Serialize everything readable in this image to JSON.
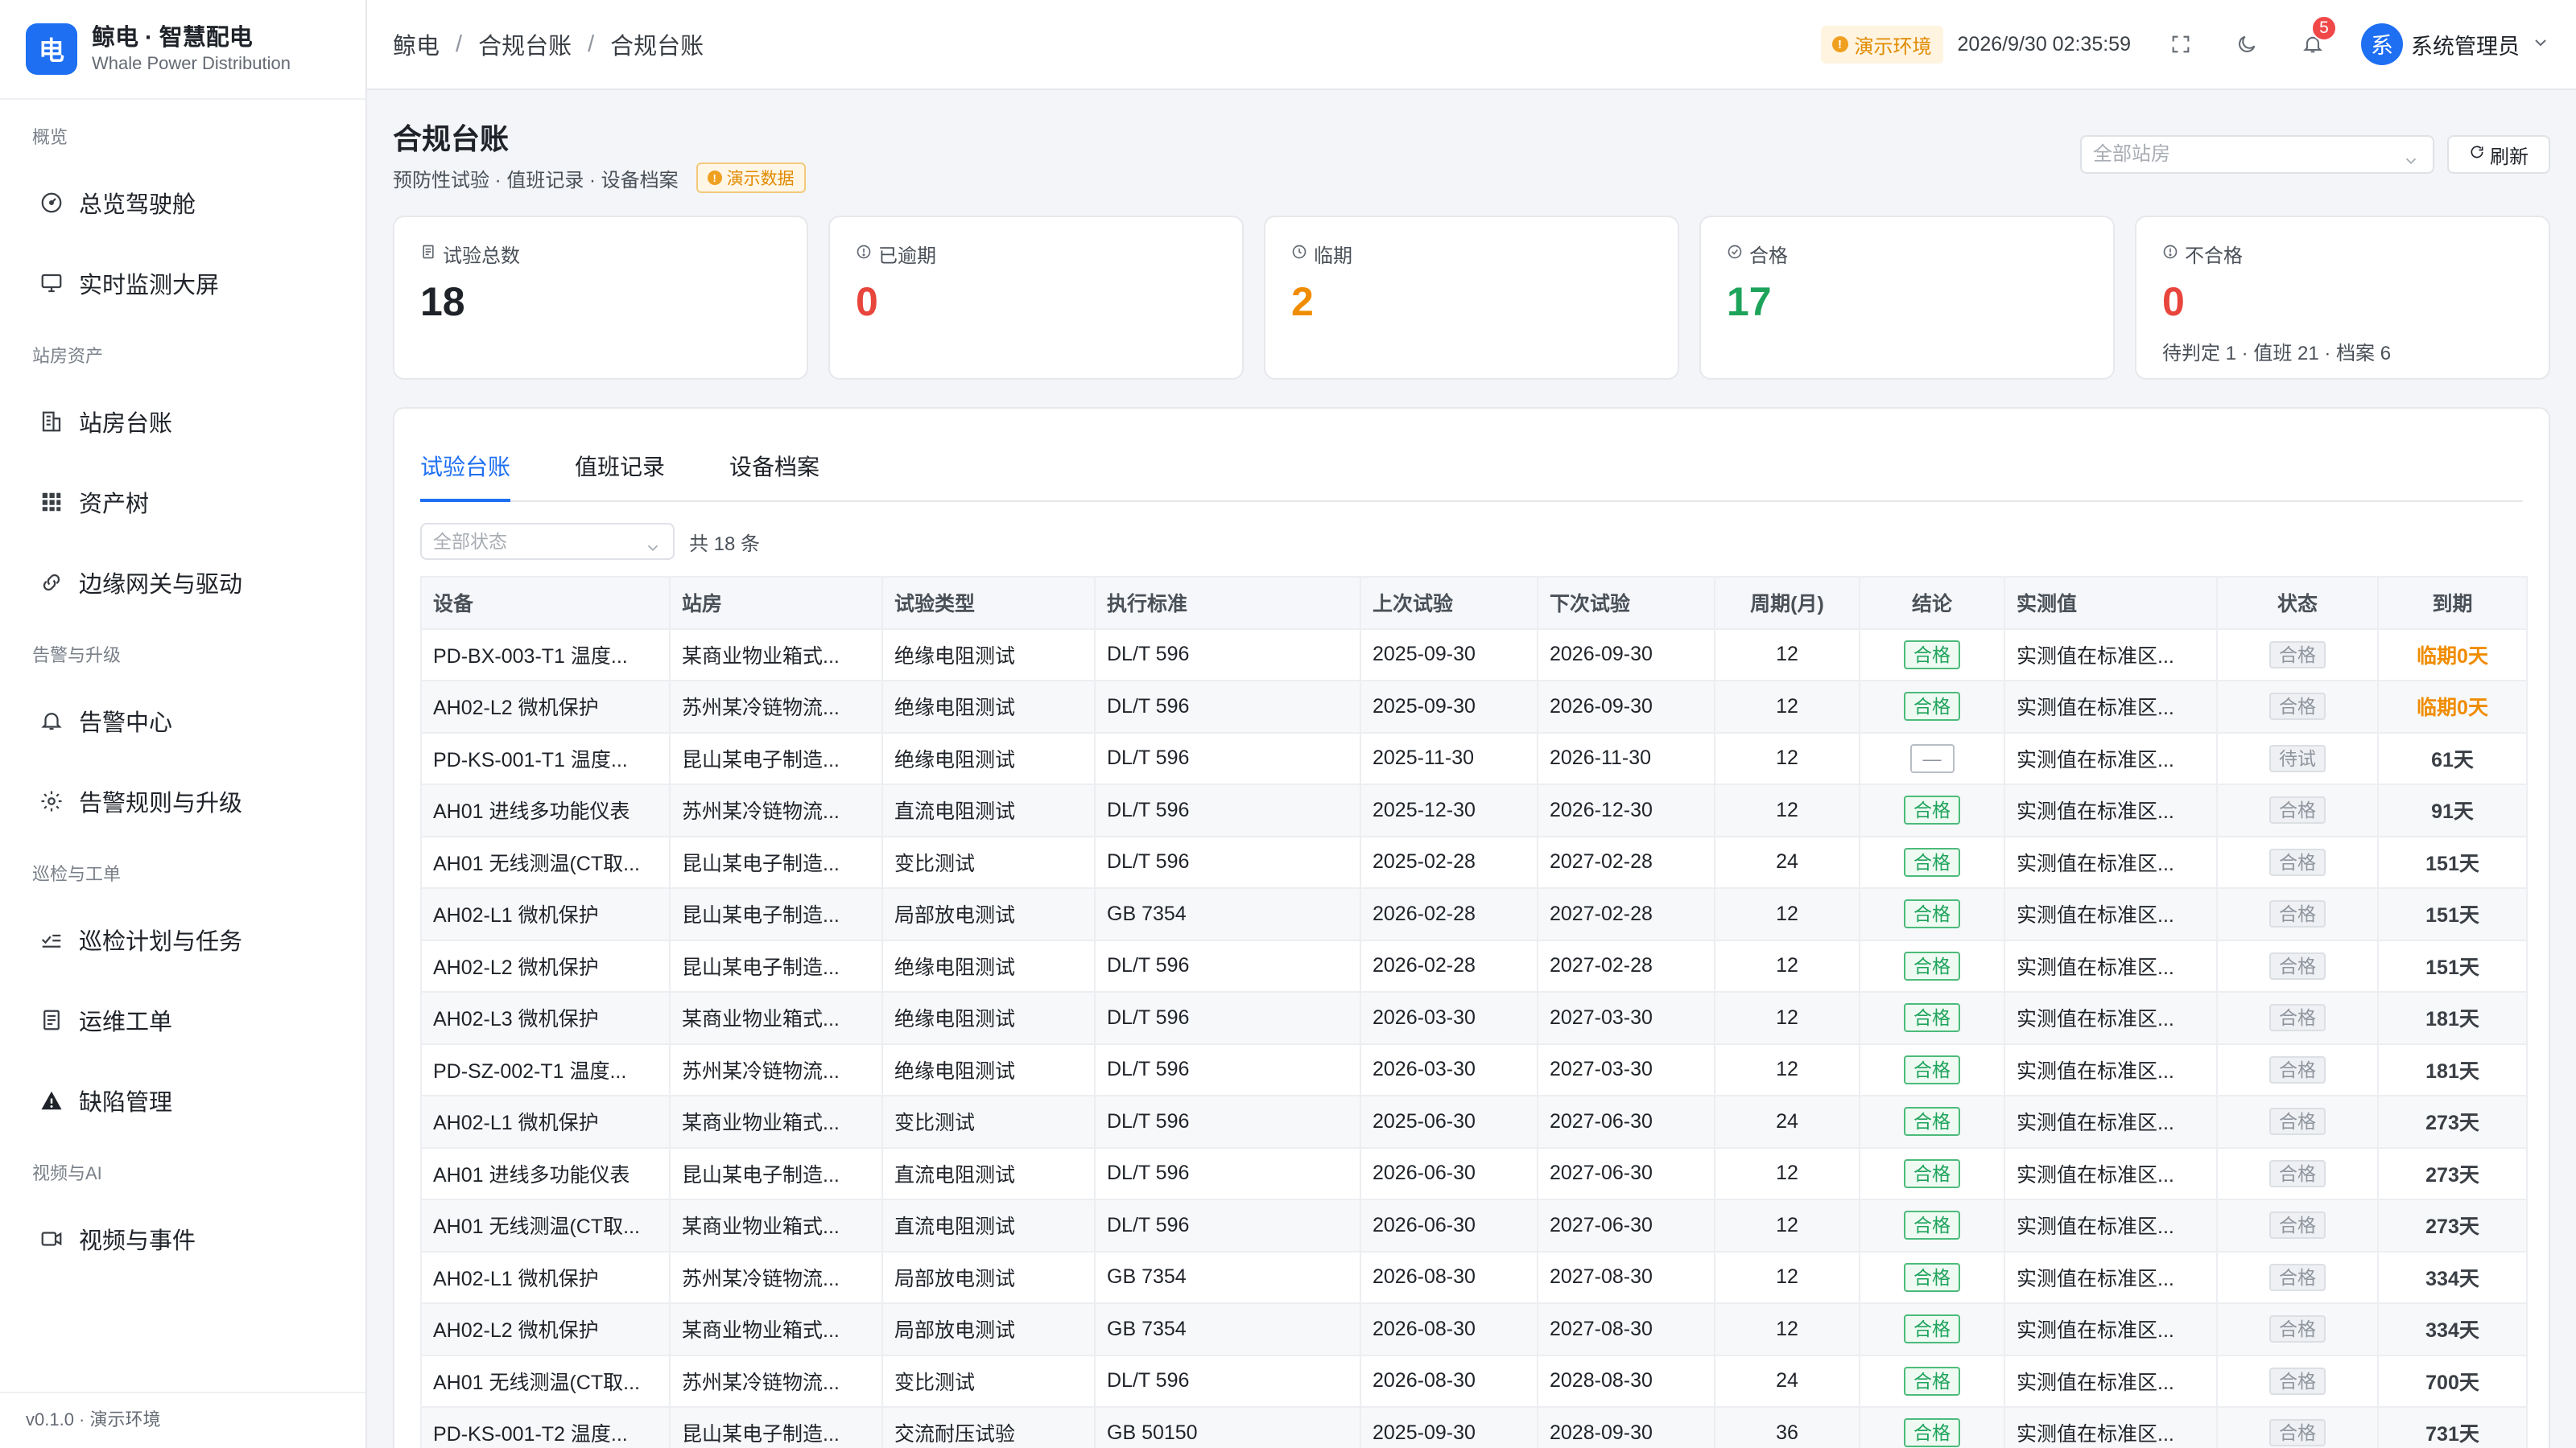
{
  "brand": {
    "logo_char": "电",
    "title": "鲸电 · 智慧配电",
    "subtitle": "Whale Power Distribution"
  },
  "sidebar": {
    "groups": [
      {
        "title": "概览",
        "items": [
          {
            "label": "总览驾驶舱",
            "icon": "dashboard-icon"
          },
          {
            "label": "实时监测大屏",
            "icon": "monitor-icon"
          }
        ]
      },
      {
        "title": "站房资产",
        "items": [
          {
            "label": "站房台账",
            "icon": "building-icon"
          },
          {
            "label": "资产树",
            "icon": "grid-icon"
          },
          {
            "label": "边缘网关与驱动",
            "icon": "link-icon"
          }
        ]
      },
      {
        "title": "告警与升级",
        "items": [
          {
            "label": "告警中心",
            "icon": "bell-icon"
          },
          {
            "label": "告警规则与升级",
            "icon": "gear-icon"
          }
        ]
      },
      {
        "title": "巡检与工单",
        "items": [
          {
            "label": "巡检计划与任务",
            "icon": "checklist-icon"
          },
          {
            "label": "运维工单",
            "icon": "document-icon"
          },
          {
            "label": "缺陷管理",
            "icon": "warning-icon"
          }
        ]
      },
      {
        "title": "视频与AI",
        "items": [
          {
            "label": "视频与事件",
            "icon": "video-icon"
          }
        ]
      }
    ],
    "footer": "v0.1.0 · 演示环境"
  },
  "header": {
    "breadcrumb": [
      "鲸电",
      "合规台账",
      "合规台账"
    ],
    "env_badge": "演示环境",
    "datetime": "2026/9/30 02:35:59",
    "notification_count": "5",
    "avatar_char": "系",
    "username": "系统管理员"
  },
  "page": {
    "title": "合规台账",
    "subtitle": "预防性试验 · 值班记录 · 设备档案",
    "demo_tag": "演示数据",
    "station_placeholder": "全部站房",
    "refresh_label": "刷新"
  },
  "stats": [
    {
      "label": "试验总数",
      "value": "18",
      "color": "#1f2329",
      "icon": "document-icon"
    },
    {
      "label": "已逾期",
      "value": "0",
      "color": "#e8453c",
      "icon": "alert-circle-icon"
    },
    {
      "label": "临期",
      "value": "2",
      "color": "#f08c00",
      "icon": "clock-icon"
    },
    {
      "label": "合格",
      "value": "17",
      "color": "#1ea35b",
      "icon": "check-circle-icon"
    },
    {
      "label": "不合格",
      "value": "0",
      "color": "#e8453c",
      "icon": "alert-circle-icon",
      "extra": "待判定 1 · 值班 21 · 档案 6"
    }
  ],
  "tabs": [
    "试验台账",
    "值班记录",
    "设备档案"
  ],
  "filter": {
    "status_placeholder": "全部状态",
    "total": "共 18 条"
  },
  "table": {
    "columns": [
      "设备",
      "站房",
      "试验类型",
      "执行标准",
      "上次试验",
      "下次试验",
      "周期(月)",
      "结论",
      "实测值",
      "状态",
      "到期"
    ],
    "rows": [
      [
        "PD-BX-003-T1 温度...",
        "某商业物业箱式...",
        "绝缘电阻测试",
        "DL/T 596",
        "2025-09-30",
        "2026-09-30",
        "12",
        "合格",
        "实测值在标准区...",
        "合格",
        "临期0天"
      ],
      [
        "AH02-L2 微机保护",
        "苏州某冷链物流...",
        "绝缘电阻测试",
        "DL/T 596",
        "2025-09-30",
        "2026-09-30",
        "12",
        "合格",
        "实测值在标准区...",
        "合格",
        "临期0天"
      ],
      [
        "PD-KS-001-T1 温度...",
        "昆山某电子制造...",
        "绝缘电阻测试",
        "DL/T 596",
        "2025-11-30",
        "2026-11-30",
        "12",
        "—",
        "实测值在标准区...",
        "待试",
        "61天"
      ],
      [
        "AH01 进线多功能仪表",
        "苏州某冷链物流...",
        "直流电阻测试",
        "DL/T 596",
        "2025-12-30",
        "2026-12-30",
        "12",
        "合格",
        "实测值在标准区...",
        "合格",
        "91天"
      ],
      [
        "AH01 无线测温(CT取...",
        "昆山某电子制造...",
        "变比测试",
        "DL/T 596",
        "2025-02-28",
        "2027-02-28",
        "24",
        "合格",
        "实测值在标准区...",
        "合格",
        "151天"
      ],
      [
        "AH02-L1 微机保护",
        "昆山某电子制造...",
        "局部放电测试",
        "GB 7354",
        "2026-02-28",
        "2027-02-28",
        "12",
        "合格",
        "实测值在标准区...",
        "合格",
        "151天"
      ],
      [
        "AH02-L2 微机保护",
        "昆山某电子制造...",
        "绝缘电阻测试",
        "DL/T 596",
        "2026-02-28",
        "2027-02-28",
        "12",
        "合格",
        "实测值在标准区...",
        "合格",
        "151天"
      ],
      [
        "AH02-L3 微机保护",
        "某商业物业箱式...",
        "绝缘电阻测试",
        "DL/T 596",
        "2026-03-30",
        "2027-03-30",
        "12",
        "合格",
        "实测值在标准区...",
        "合格",
        "181天"
      ],
      [
        "PD-SZ-002-T1 温度...",
        "苏州某冷链物流...",
        "绝缘电阻测试",
        "DL/T 596",
        "2026-03-30",
        "2027-03-30",
        "12",
        "合格",
        "实测值在标准区...",
        "合格",
        "181天"
      ],
      [
        "AH02-L1 微机保护",
        "某商业物业箱式...",
        "变比测试",
        "DL/T 596",
        "2025-06-30",
        "2027-06-30",
        "24",
        "合格",
        "实测值在标准区...",
        "合格",
        "273天"
      ],
      [
        "AH01 进线多功能仪表",
        "昆山某电子制造...",
        "直流电阻测试",
        "DL/T 596",
        "2026-06-30",
        "2027-06-30",
        "12",
        "合格",
        "实测值在标准区...",
        "合格",
        "273天"
      ],
      [
        "AH01 无线测温(CT取...",
        "某商业物业箱式...",
        "直流电阻测试",
        "DL/T 596",
        "2026-06-30",
        "2027-06-30",
        "12",
        "合格",
        "实测值在标准区...",
        "合格",
        "273天"
      ],
      [
        "AH02-L1 微机保护",
        "苏州某冷链物流...",
        "局部放电测试",
        "GB 7354",
        "2026-08-30",
        "2027-08-30",
        "12",
        "合格",
        "实测值在标准区...",
        "合格",
        "334天"
      ],
      [
        "AH02-L2 微机保护",
        "某商业物业箱式...",
        "局部放电测试",
        "GB 7354",
        "2026-08-30",
        "2027-08-30",
        "12",
        "合格",
        "实测值在标准区...",
        "合格",
        "334天"
      ],
      [
        "AH01 无线测温(CT取...",
        "苏州某冷链物流...",
        "变比测试",
        "DL/T 596",
        "2026-08-30",
        "2028-08-30",
        "24",
        "合格",
        "实测值在标准区...",
        "合格",
        "700天"
      ],
      [
        "PD-KS-001-T2 温度...",
        "昆山某电子制造...",
        "交流耐压试验",
        "GB 50150",
        "2025-09-30",
        "2028-09-30",
        "36",
        "合格",
        "实测值在标准区...",
        "合格",
        "731天"
      ]
    ]
  }
}
